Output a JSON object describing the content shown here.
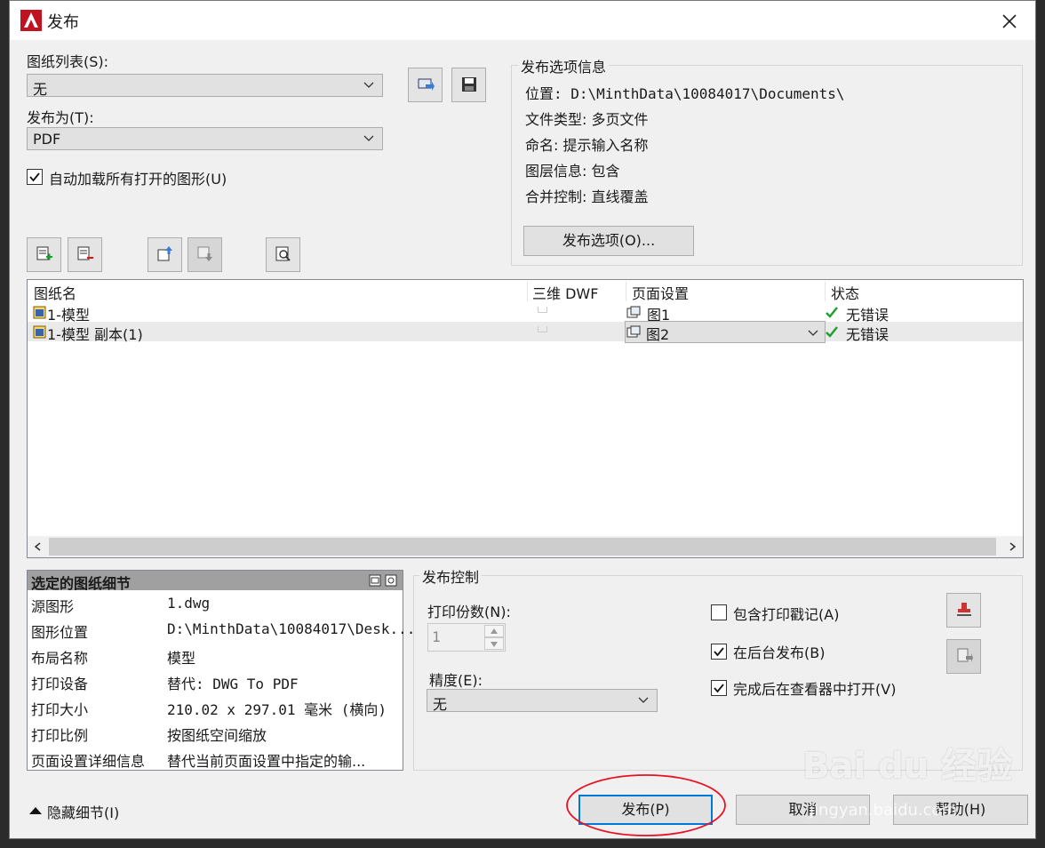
{
  "window": {
    "title": "发布"
  },
  "sheet_list": {
    "label": "图纸列表(S):",
    "value": "无"
  },
  "publish_to": {
    "label": "发布为(T):",
    "value": "PDF"
  },
  "auto_load": {
    "label": "自动加载所有打开的图形(U)",
    "checked": true
  },
  "publish_info": {
    "title": "发布选项信息",
    "location": "位置: D:\\MinthData\\10084017\\Documents\\",
    "file_type": "文件类型: 多页文件",
    "naming": "命名: 提示输入名称",
    "layer_info": "图层信息: 包含",
    "merge": "合并控制: 直线覆盖",
    "options_button": "发布选项(O)..."
  },
  "table": {
    "columns": [
      "图纸名",
      "三维 DWF",
      "页面设置",
      "状态"
    ],
    "rows": [
      {
        "name": "1-模型",
        "page_setup": "图1",
        "status": "无错误"
      },
      {
        "name": "1-模型 副本(1)",
        "page_setup": "图2",
        "status": "无错误"
      }
    ]
  },
  "details": {
    "title": "选定的图纸细节",
    "rows": [
      {
        "key": "源图形",
        "value": "1.dwg"
      },
      {
        "key": "图形位置",
        "value": "D:\\MinthData\\10084017\\Desk..."
      },
      {
        "key": "布局名称",
        "value": "模型"
      },
      {
        "key": "打印设备",
        "value": "替代: DWG To PDF"
      },
      {
        "key": "打印大小",
        "value": "210.02 x 297.01 毫米 (横向)"
      },
      {
        "key": "打印比例",
        "value": "按图纸空间缩放"
      },
      {
        "key": "页面设置详细信息",
        "value": "替代当前页面设置中指定的输..."
      }
    ]
  },
  "publish_control": {
    "title": "发布控制",
    "copies_label": "打印份数(N):",
    "copies_value": "1",
    "precision_label": "精度(E):",
    "precision_value": "无",
    "include_stamp": "包含打印戳记(A)",
    "background": "在后台发布(B)",
    "open_viewer": "完成后在查看器中打开(V)"
  },
  "footer": {
    "hide_details": "隐藏细节(I)",
    "publish": "发布(P)",
    "cancel": "取消",
    "help": "帮助(H)"
  },
  "watermark": {
    "brand": "Bai du 经验",
    "url": "jingyan.baidu.com"
  },
  "colors": {
    "accent": "#0078d7",
    "check": "#1e9e2e",
    "highlight": "#e81123"
  }
}
